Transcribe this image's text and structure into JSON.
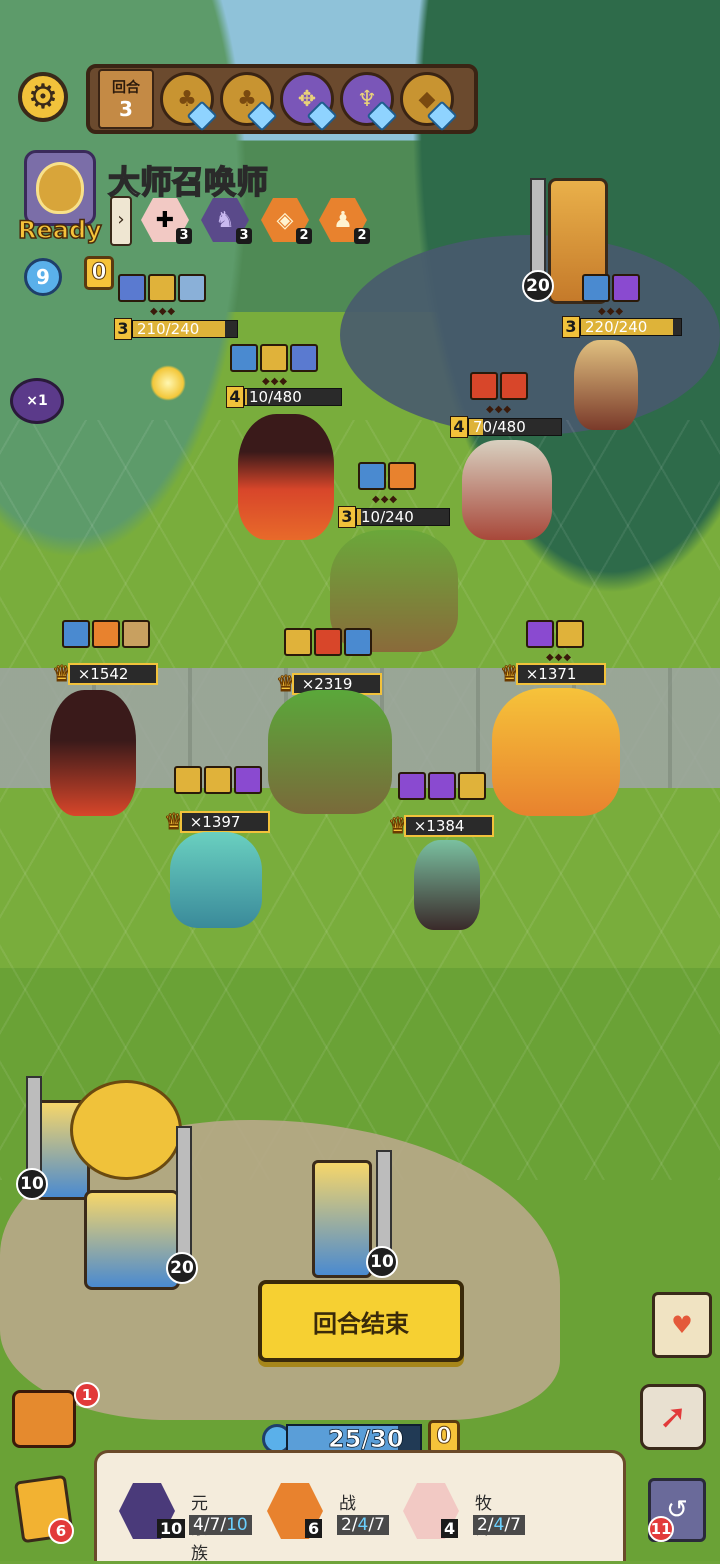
{
  "hud": {
    "round_label": "回合",
    "round_number": "3",
    "round_icons": [
      "gold-tree-icon",
      "gold-tree-icon",
      "purple-rune-icon",
      "purple-chalice-icon",
      "gold-stone-icon"
    ]
  },
  "player": {
    "title": "大师召唤师",
    "ready_text": "Ready",
    "potion_count": "9",
    "gold": "0",
    "speed_label": "×1",
    "traits": [
      {
        "icon": "priest-icon",
        "count": "3"
      },
      {
        "icon": "elemental-icon",
        "count": "3"
      },
      {
        "icon": "warrior-icon",
        "count": "2"
      },
      {
        "icon": "fighter-icon",
        "count": "2"
      }
    ]
  },
  "enemies": [
    {
      "level": "3",
      "hp": "210/240",
      "hp_fraction": 0.88
    },
    {
      "level": "4",
      "hp": "10/480",
      "hp_fraction": 0.02
    },
    {
      "level": "3",
      "hp": "10/240",
      "hp_fraction": 0.04
    },
    {
      "level": "4",
      "hp": "70/480",
      "hp_fraction": 0.15
    },
    {
      "level": "3",
      "hp": "220/240",
      "hp_fraction": 0.92
    }
  ],
  "enemy_tower_cost": "20",
  "allies": [
    {
      "power": "×1542"
    },
    {
      "power": "×2319"
    },
    {
      "power": "×1371"
    },
    {
      "power": "×1397"
    },
    {
      "power": "×1384"
    }
  ],
  "bench_towers": [
    {
      "cost": "10"
    },
    {
      "cost": "20"
    },
    {
      "cost": "10"
    }
  ],
  "end_turn_label": "回合结束",
  "chest_badge": "1",
  "mana": {
    "text": "25/30",
    "fraction": 0.8333
  },
  "bottom_gold": "0",
  "deck_count": "6",
  "discard_count": "11",
  "synergies": [
    {
      "name": "元素族",
      "count": "10",
      "progress_prefix": "4/7/",
      "progress_highlight": "10"
    },
    {
      "name": "战士",
      "count": "6",
      "progress_prefix": "2/",
      "progress_highlight": "4",
      "progress_suffix": "/7"
    },
    {
      "name": "牧师",
      "count": "4",
      "progress_prefix": "2/",
      "progress_highlight": "4",
      "progress_suffix": "/7"
    }
  ]
}
